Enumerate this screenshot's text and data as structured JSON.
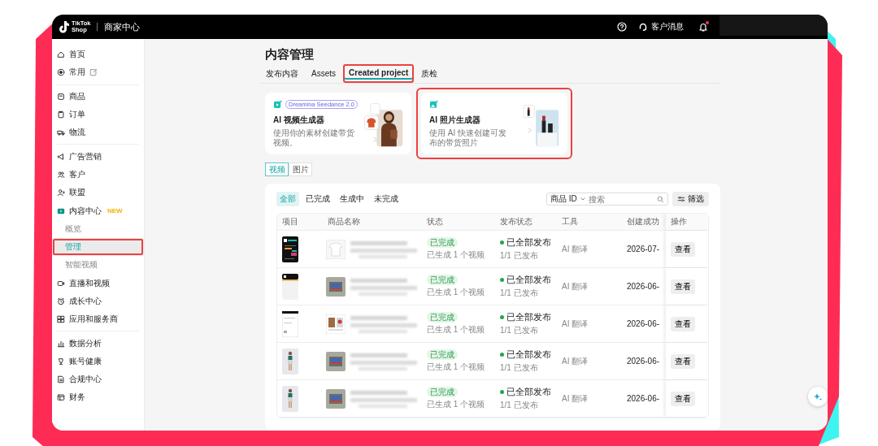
{
  "topbar": {
    "logo_line_1": "TikTok",
    "logo_line_2": "Shop",
    "app_name": "商家中心",
    "messages_label": "客户消息",
    "notification_dot": true
  },
  "sidebar": {
    "groups": [
      [
        {
          "label": "首页"
        },
        {
          "label": "常用",
          "editable": true
        }
      ],
      [
        {
          "label": "商品"
        },
        {
          "label": "订单"
        },
        {
          "label": "物流"
        }
      ],
      [
        {
          "label": "广告营销"
        },
        {
          "label": "客户"
        },
        {
          "label": "联盟"
        },
        {
          "label": "内容中心",
          "badge": "NEW",
          "children": [
            {
              "label": "概览",
              "selected": false,
              "highlighted": false
            },
            {
              "label": "管理",
              "selected": true,
              "highlighted": true
            },
            {
              "label": "智能视频",
              "selected": false,
              "highlighted": false
            }
          ]
        },
        {
          "label": "直播和视频"
        },
        {
          "label": "成长中心"
        },
        {
          "label": "应用和服务商"
        }
      ],
      [
        {
          "label": "数据分析"
        },
        {
          "label": "账号健康"
        },
        {
          "label": "合规中心"
        },
        {
          "label": "财务"
        }
      ]
    ]
  },
  "page": {
    "title": "内容管理",
    "tabs": [
      {
        "label": "发布内容",
        "selected": false,
        "highlighted": false
      },
      {
        "label": "Assets",
        "selected": false,
        "highlighted": false
      },
      {
        "label": "Created project",
        "selected": true,
        "highlighted": true
      },
      {
        "label": "质检",
        "selected": false,
        "highlighted": false
      }
    ],
    "generators": [
      {
        "badge": "Dreamina Seedance 2.0",
        "title": "AI 视频生成器",
        "description": "使用你的素材创建带货视频。",
        "highlighted": false
      },
      {
        "title": "AI 照片生成器",
        "description": "使用 AI 快速创建可发布的带货照片",
        "highlighted": true
      }
    ],
    "media_toggle": [
      {
        "label": "视频",
        "selected": true
      },
      {
        "label": "图片",
        "selected": false
      }
    ],
    "status_filters": [
      {
        "label": "全部",
        "selected": true
      },
      {
        "label": "已完成",
        "selected": false
      },
      {
        "label": "生成中",
        "selected": false
      },
      {
        "label": "未完成",
        "selected": false
      }
    ],
    "search": {
      "field_select": "商品 ID",
      "placeholder": "搜索"
    },
    "filter_button": "筛选",
    "table": {
      "columns": [
        "项目",
        "商品名称",
        "状态",
        "发布状态",
        "工具",
        "创建成功",
        "操作"
      ],
      "rows": [
        {
          "status": "已完成",
          "status_detail": "已生成 1 个视频",
          "publish_status": "已全部发布",
          "publish_detail": "1/1 已发布",
          "tool": "AI 翻译",
          "created": "2026-07-",
          "action": "查看"
        },
        {
          "status": "已完成",
          "status_detail": "已生成 1 个视频",
          "publish_status": "已全部发布",
          "publish_detail": "1/1 已发布",
          "tool": "AI 翻译",
          "created": "2026-06-",
          "action": "查看"
        },
        {
          "status": "已完成",
          "status_detail": "已生成 1 个视频",
          "publish_status": "已全部发布",
          "publish_detail": "1/1 已发布",
          "tool": "AI 翻译",
          "created": "2026-06-",
          "action": "查看"
        },
        {
          "status": "已完成",
          "status_detail": "已生成 1 个视频",
          "publish_status": "已全部发布",
          "publish_detail": "1/1 已发布",
          "tool": "AI 翻译",
          "created": "2026-06-",
          "action": "查看"
        },
        {
          "status": "已完成",
          "status_detail": "已生成 1 个视频",
          "publish_status": "已全部发布",
          "publish_detail": "1/1 已发布",
          "tool": "AI 翻译",
          "created": "2026-06-",
          "action": "查看"
        }
      ]
    }
  }
}
